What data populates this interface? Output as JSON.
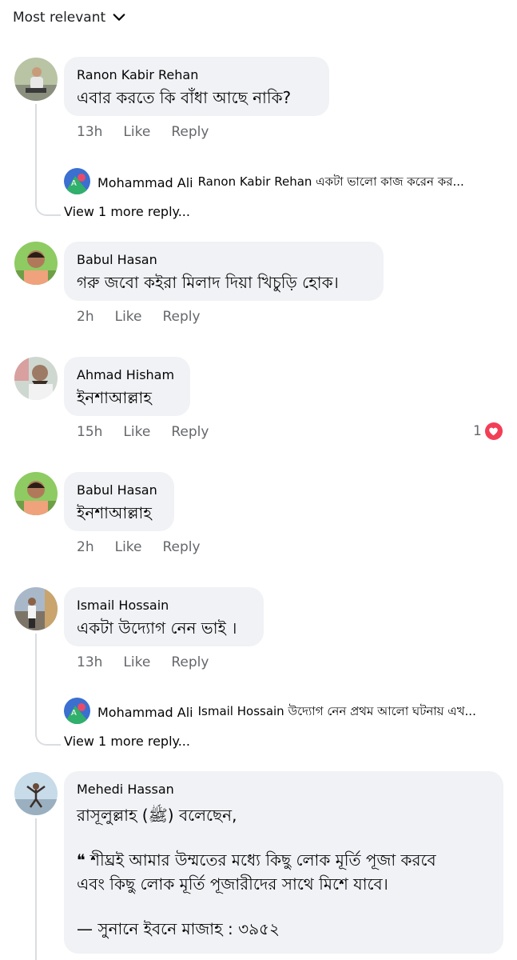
{
  "sort": {
    "label": "Most relevant"
  },
  "comments": [
    {
      "author": "Ranon Kabir Rehan",
      "text": "এবার করতে কি বাঁধা আছে নাকি?",
      "time": "13h",
      "like": "Like",
      "reply": "Reply",
      "reply_preview": {
        "author": "Mohammad Ali",
        "text": "Ranon Kabir Rehan একটা ভালো কাজ করেন কর..."
      },
      "more_replies": "View 1 more reply..."
    },
    {
      "author": "Babul Hasan",
      "text": "গরু জবো কইরা মিলাদ দিয়া খিচুড়ি হোক।",
      "time": "2h",
      "like": "Like",
      "reply": "Reply"
    },
    {
      "author": "Ahmad Hisham",
      "text": "ইনশাআল্লাহ",
      "time": "15h",
      "like": "Like",
      "reply": "Reply",
      "reaction_count": "1"
    },
    {
      "author": "Babul Hasan",
      "text": "ইনশাআল্লাহ",
      "time": "2h",
      "like": "Like",
      "reply": "Reply"
    },
    {
      "author": "Ismail Hossain",
      "text": "একটা উদ্যোগ নেন ভাই ।",
      "time": "13h",
      "like": "Like",
      "reply": "Reply",
      "reply_preview": {
        "author": "Mohammad Ali",
        "text": "Ismail Hossain উদ্যোগ নেন প্রথম আলো ঘটনায় এখ..."
      },
      "more_replies": "View 1 more reply..."
    },
    {
      "author": "Mehedi Hassan",
      "lines": [
        "রাসূলুল্লাহ (ﷺ) বলেছেন,",
        "❝ শীঘ্রই আমার উম্মতের মধ্যে কিছু লোক মূর্তি পূজা করবে",
        "এবং কিছু লোক মূর্তি পূজারীদের সাথে মিশে যাবে।",
        "— সুনানে ইবনে মাজাহ : ৩৯৫২"
      ]
    }
  ]
}
